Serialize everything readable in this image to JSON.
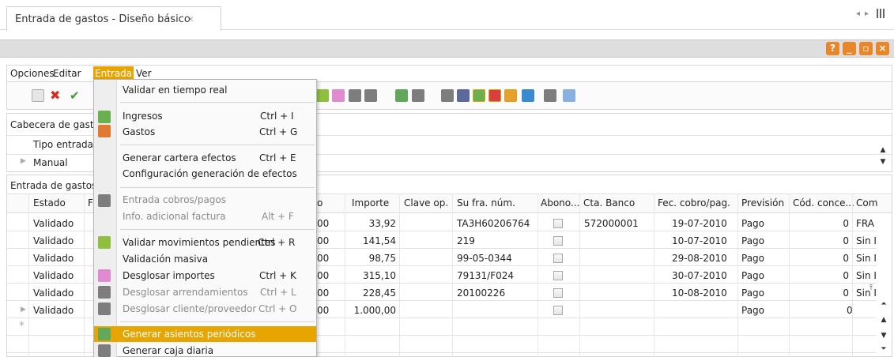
{
  "tab": {
    "title": "Entrada de gastos - Diseño básico",
    "close": "×"
  },
  "window_buttons": {
    "help": "?",
    "minimize": "_",
    "restore": "▫",
    "close": "×"
  },
  "menubar": {
    "opciones": "Opciones",
    "editar": "Editar",
    "entrada": "Entrada",
    "ver": "Ver"
  },
  "header_section": {
    "title": "Cabecera de gast",
    "field_label": "Tipo entrada",
    "field_value": "Manual"
  },
  "grid_section": {
    "title": "Entrada de gastos"
  },
  "columns": {
    "estado": "Estado",
    "f": "F",
    "o": "o",
    "importe": "Importe",
    "clave_op": "Clave op.",
    "su_fra": "Su fra. núm.",
    "abono": "Abono...",
    "cta_banco": "Cta. Banco",
    "fec_cobro": "Fec. cobro/pag.",
    "prevision": "Previsión",
    "cod_conce": "Cód. conce...",
    "com": "Com"
  },
  "rows": [
    {
      "estado": "Validado",
      "o": "00",
      "importe": "33,92",
      "su_fra": "TA3H60206764",
      "cta_banco": "572000001",
      "fec": "19-07-2010",
      "prevision": "Pago",
      "cod": "0",
      "com": "FRA"
    },
    {
      "estado": "Validado",
      "o": "00",
      "importe": "141,54",
      "su_fra": "219",
      "cta_banco": "",
      "fec": "10-07-2010",
      "prevision": "Pago",
      "cod": "0",
      "com": "Sin I"
    },
    {
      "estado": "Validado",
      "o": "00",
      "importe": "98,75",
      "su_fra": "99-05-0344",
      "cta_banco": "",
      "fec": "29-08-2010",
      "prevision": "Pago",
      "cod": "0",
      "com": "Sin I"
    },
    {
      "estado": "Validado",
      "o": "00",
      "importe": "315,10",
      "su_fra": "79131/F024",
      "cta_banco": "",
      "fec": "30-07-2010",
      "prevision": "Pago",
      "cod": "0",
      "com": "Sin I"
    },
    {
      "estado": "Validado",
      "o": "00",
      "importe": "228,45",
      "su_fra": "20100226",
      "cta_banco": "",
      "fec": "10-08-2010",
      "prevision": "Pago",
      "cod": "0",
      "com": "Sin I"
    },
    {
      "estado": "Validado",
      "o": "00",
      "importe": "1.000,00",
      "su_fra": "",
      "cta_banco": "",
      "fec": "",
      "prevision": "Pago",
      "cod": "0",
      "com": ""
    }
  ],
  "new_row_marker": "*",
  "menu": {
    "validar_tiempo_real": "Validar en tiempo real",
    "ingresos": "Ingresos",
    "ingresos_sc": "Ctrl + I",
    "gastos": "Gastos",
    "gastos_sc": "Ctrl + G",
    "generar_cartera": "Generar cartera efectos",
    "generar_cartera_sc": "Ctrl + E",
    "config_efectos": "Configuración generación de efectos",
    "entrada_cobros": "Entrada cobros/pagos",
    "info_adicional": "Info. adicional factura",
    "info_adicional_sc": "Alt + F",
    "validar_movimientos": "Validar movimientos pendientes",
    "validar_movimientos_sc": "Ctrl + R",
    "validacion_masiva": "Validación masiva",
    "desglosar_importes": "Desglosar importes",
    "desglosar_importes_sc": "Ctrl + K",
    "desglosar_arrend": "Desglosar arrendamientos",
    "desglosar_arrend_sc": "Ctrl + L",
    "desglosar_cliente": "Desglosar cliente/proveedor",
    "desglosar_cliente_sc": "Ctrl + O",
    "generar_asientos": "Generar asientos periódicos",
    "generar_caja": "Generar caja diaria"
  },
  "colors": {
    "accent": "#e8a400",
    "window_btn": "#e8862a"
  }
}
